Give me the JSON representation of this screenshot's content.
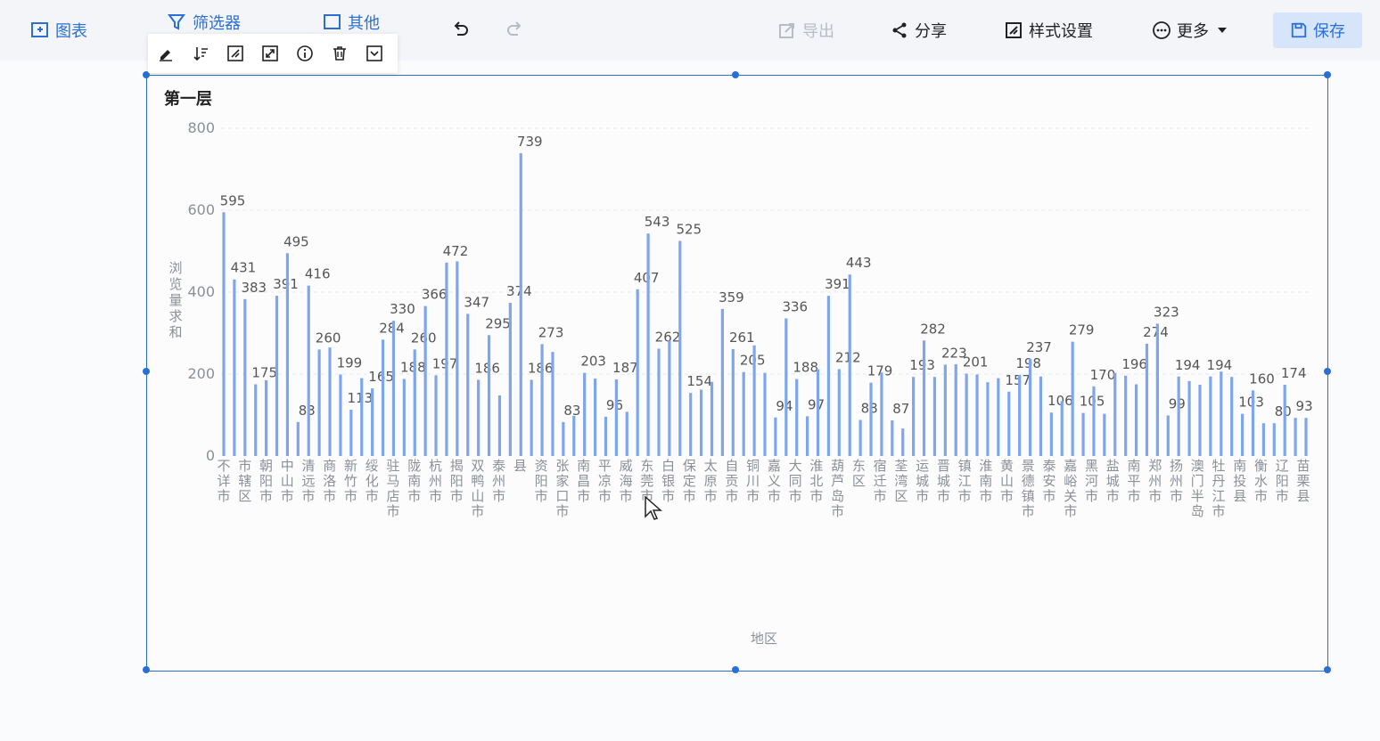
{
  "toolbar": {
    "chart_label": "图表",
    "filter_label": "筛选器",
    "other_label": "其他",
    "export_label": "导出",
    "share_label": "分享",
    "style_label": "样式设置",
    "more_label": "更多",
    "save_label": "保存"
  },
  "colors": {
    "accent": "#2a6fd6",
    "bar": "#7ea6ee"
  },
  "chart_title": "第一层",
  "chart_data": {
    "type": "bar",
    "ylabel": "浏览量求和",
    "xlabel": "地区",
    "ylim": [
      0,
      800
    ],
    "yticks": [
      "0",
      "200",
      "400",
      "600",
      "800"
    ],
    "grid": true,
    "categories": [
      "不详市",
      "市辖区",
      "朝阳市",
      "中山市",
      "清远市",
      "商洛市",
      "新竹市",
      "绥化市",
      "驻马店市",
      "陇南市",
      "杭州市",
      "揭阳市",
      "双鸭山市",
      "泰州市",
      "县",
      "资阳市",
      "张家口市",
      "南昌市",
      "平凉市",
      "威海市",
      "东莞市",
      "白银市",
      "保定市",
      "太原市",
      "自贡市",
      "铜川市",
      "嘉义市",
      "大同市",
      "淮北市",
      "葫芦岛市",
      "东区",
      "宿迁市",
      "荃湾区",
      "运城市",
      "晋城市",
      "镇江市",
      "淮南市",
      "黄山市",
      "景德镇市",
      "泰安市",
      "嘉峪关市",
      "黑河市",
      "盐城市",
      "南平市",
      "郑州市",
      "扬州市",
      "澳门半岛",
      "牡丹江市",
      "南投县",
      "衡水市",
      "辽阳市",
      "苗栗县"
    ],
    "values": [
      595,
      431,
      383,
      175,
      185,
      391,
      495,
      83,
      416,
      260,
      265,
      199,
      113,
      190,
      165,
      284,
      330,
      188,
      260,
      366,
      197,
      472,
      475,
      347,
      186,
      295,
      148,
      374,
      739,
      186,
      273,
      254,
      83,
      98,
      203,
      189,
      96,
      187,
      108,
      407,
      543,
      262,
      282,
      525,
      154,
      162,
      181,
      359,
      261,
      205,
      270,
      203,
      94,
      336,
      188,
      97,
      212,
      391,
      212,
      443,
      88,
      179,
      204,
      87,
      67,
      193,
      282,
      193,
      223,
      224,
      201,
      199,
      180,
      190,
      157,
      198,
      237,
      194,
      106,
      134,
      279,
      105,
      170,
      103,
      203,
      196,
      175,
      274,
      323,
      99,
      194,
      183,
      174,
      194,
      206,
      193,
      103,
      160,
      80,
      80,
      174,
      93,
      93
    ],
    "labels": {
      "0": "595",
      "1": "431",
      "2": "383",
      "3": "175",
      "5": "391",
      "6": "495",
      "7": "83",
      "8": "416",
      "9": "260",
      "11": "199",
      "12": "113",
      "14": "165",
      "15": "284",
      "16": "330",
      "17": "188",
      "18": "260",
      "19": "366",
      "20": "197",
      "21": "472",
      "23": "347",
      "24": "186",
      "25": "295",
      "27": "374",
      "28": "739",
      "29": "186",
      "30": "273",
      "32": "83",
      "34": "203",
      "36": "96",
      "37": "187",
      "39": "407",
      "40": "543",
      "41": "262",
      "43": "525",
      "44": "154",
      "47": "359",
      "48": "261",
      "49": "205",
      "52": "94",
      "53": "336",
      "54": "188",
      "55": "97",
      "57": "391",
      "58": "212",
      "59": "443",
      "60": "88",
      "61": "179",
      "63": "87",
      "65": "193",
      "66": "282",
      "68": "223",
      "70": "201",
      "74": "157",
      "75": "198",
      "76": "237",
      "78": "106",
      "80": "279",
      "81": "105",
      "82": "170",
      "85": "196",
      "87": "274",
      "88": "323",
      "89": "99",
      "90": "194",
      "93": "194",
      "96": "103",
      "97": "160",
      "99": "80",
      "100": "174",
      "101": "93"
    }
  }
}
